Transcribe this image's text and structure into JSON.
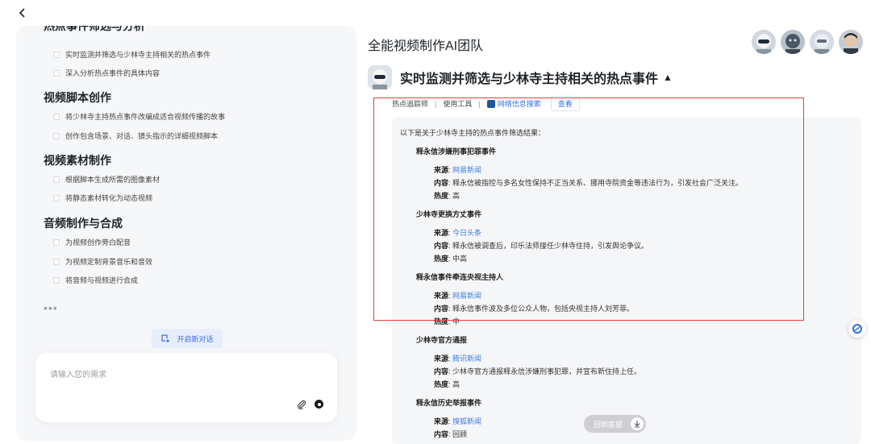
{
  "left": {
    "cut_title": "热点事件筛选与分析",
    "sections": [
      {
        "title": "视频脚本创作"
      },
      {
        "title": "视频素材制作"
      },
      {
        "title": "音频制作与合成"
      }
    ],
    "tasks": [
      "实时监测并筛选与少林寺主持相关的热点事件",
      "深入分析热点事件的具体内容",
      "将少林寺主持热点事件改编成适合视频传播的故事",
      "创作包含场景、对话、镜头指示的详细视频脚本",
      "根据脚本生成所需的图像素材",
      "将静态素材转化为动态视频",
      "为视频创作旁白配音",
      "为视频定制背景音乐和音效",
      "将音频与视频进行合成"
    ],
    "more": "•••",
    "new_chat_label": "开启新对话",
    "input_placeholder": "请输入您的需求"
  },
  "right": {
    "team_title": "全能视频制作AI团队",
    "task_title": "实时监测并筛选与少林寺主持相关的热点事件",
    "task_caret": "▲",
    "tool": {
      "agent": "热点追踪师",
      "sep": "|",
      "use_tool": "使用工具",
      "tool_name": "网络信息搜索",
      "view": "查看"
    },
    "intro": "以下是关于少林寺主持的热点事件筛选结果：",
    "labels": {
      "source": "来源",
      "content": "内容",
      "heat": "热度"
    },
    "events": [
      {
        "title": "释永信涉嫌刑事犯罪事件",
        "source": "网易新闻",
        "content": "释永信被指控与多名女性保持不正当关系、挪用寺院资金等违法行为，引发社会广泛关注。",
        "heat": "高"
      },
      {
        "title": "少林寺更换方丈事件",
        "source": "今日头条",
        "content": "释永信被调查后，印乐法师接任少林寺住持，引发舆论争议。",
        "heat": "中高"
      },
      {
        "title": "释永信事件牵连央视主持人",
        "source": "网易新闻",
        "content": "释永信事件波及多位公众人物，包括央视主持人刘芳菲。",
        "heat": "中"
      },
      {
        "title": "少林寺官方通报",
        "source": "腾讯新闻",
        "content": "少林寺官方通报释永信涉嫌刑事犯罪，并宣布新住持上任。",
        "heat": "高"
      },
      {
        "title": "释永信历史举报事件",
        "source": "搜狐新闻",
        "content": "回顾",
        "heat": ""
      }
    ],
    "scroll_bottom_label": "回到底部"
  }
}
